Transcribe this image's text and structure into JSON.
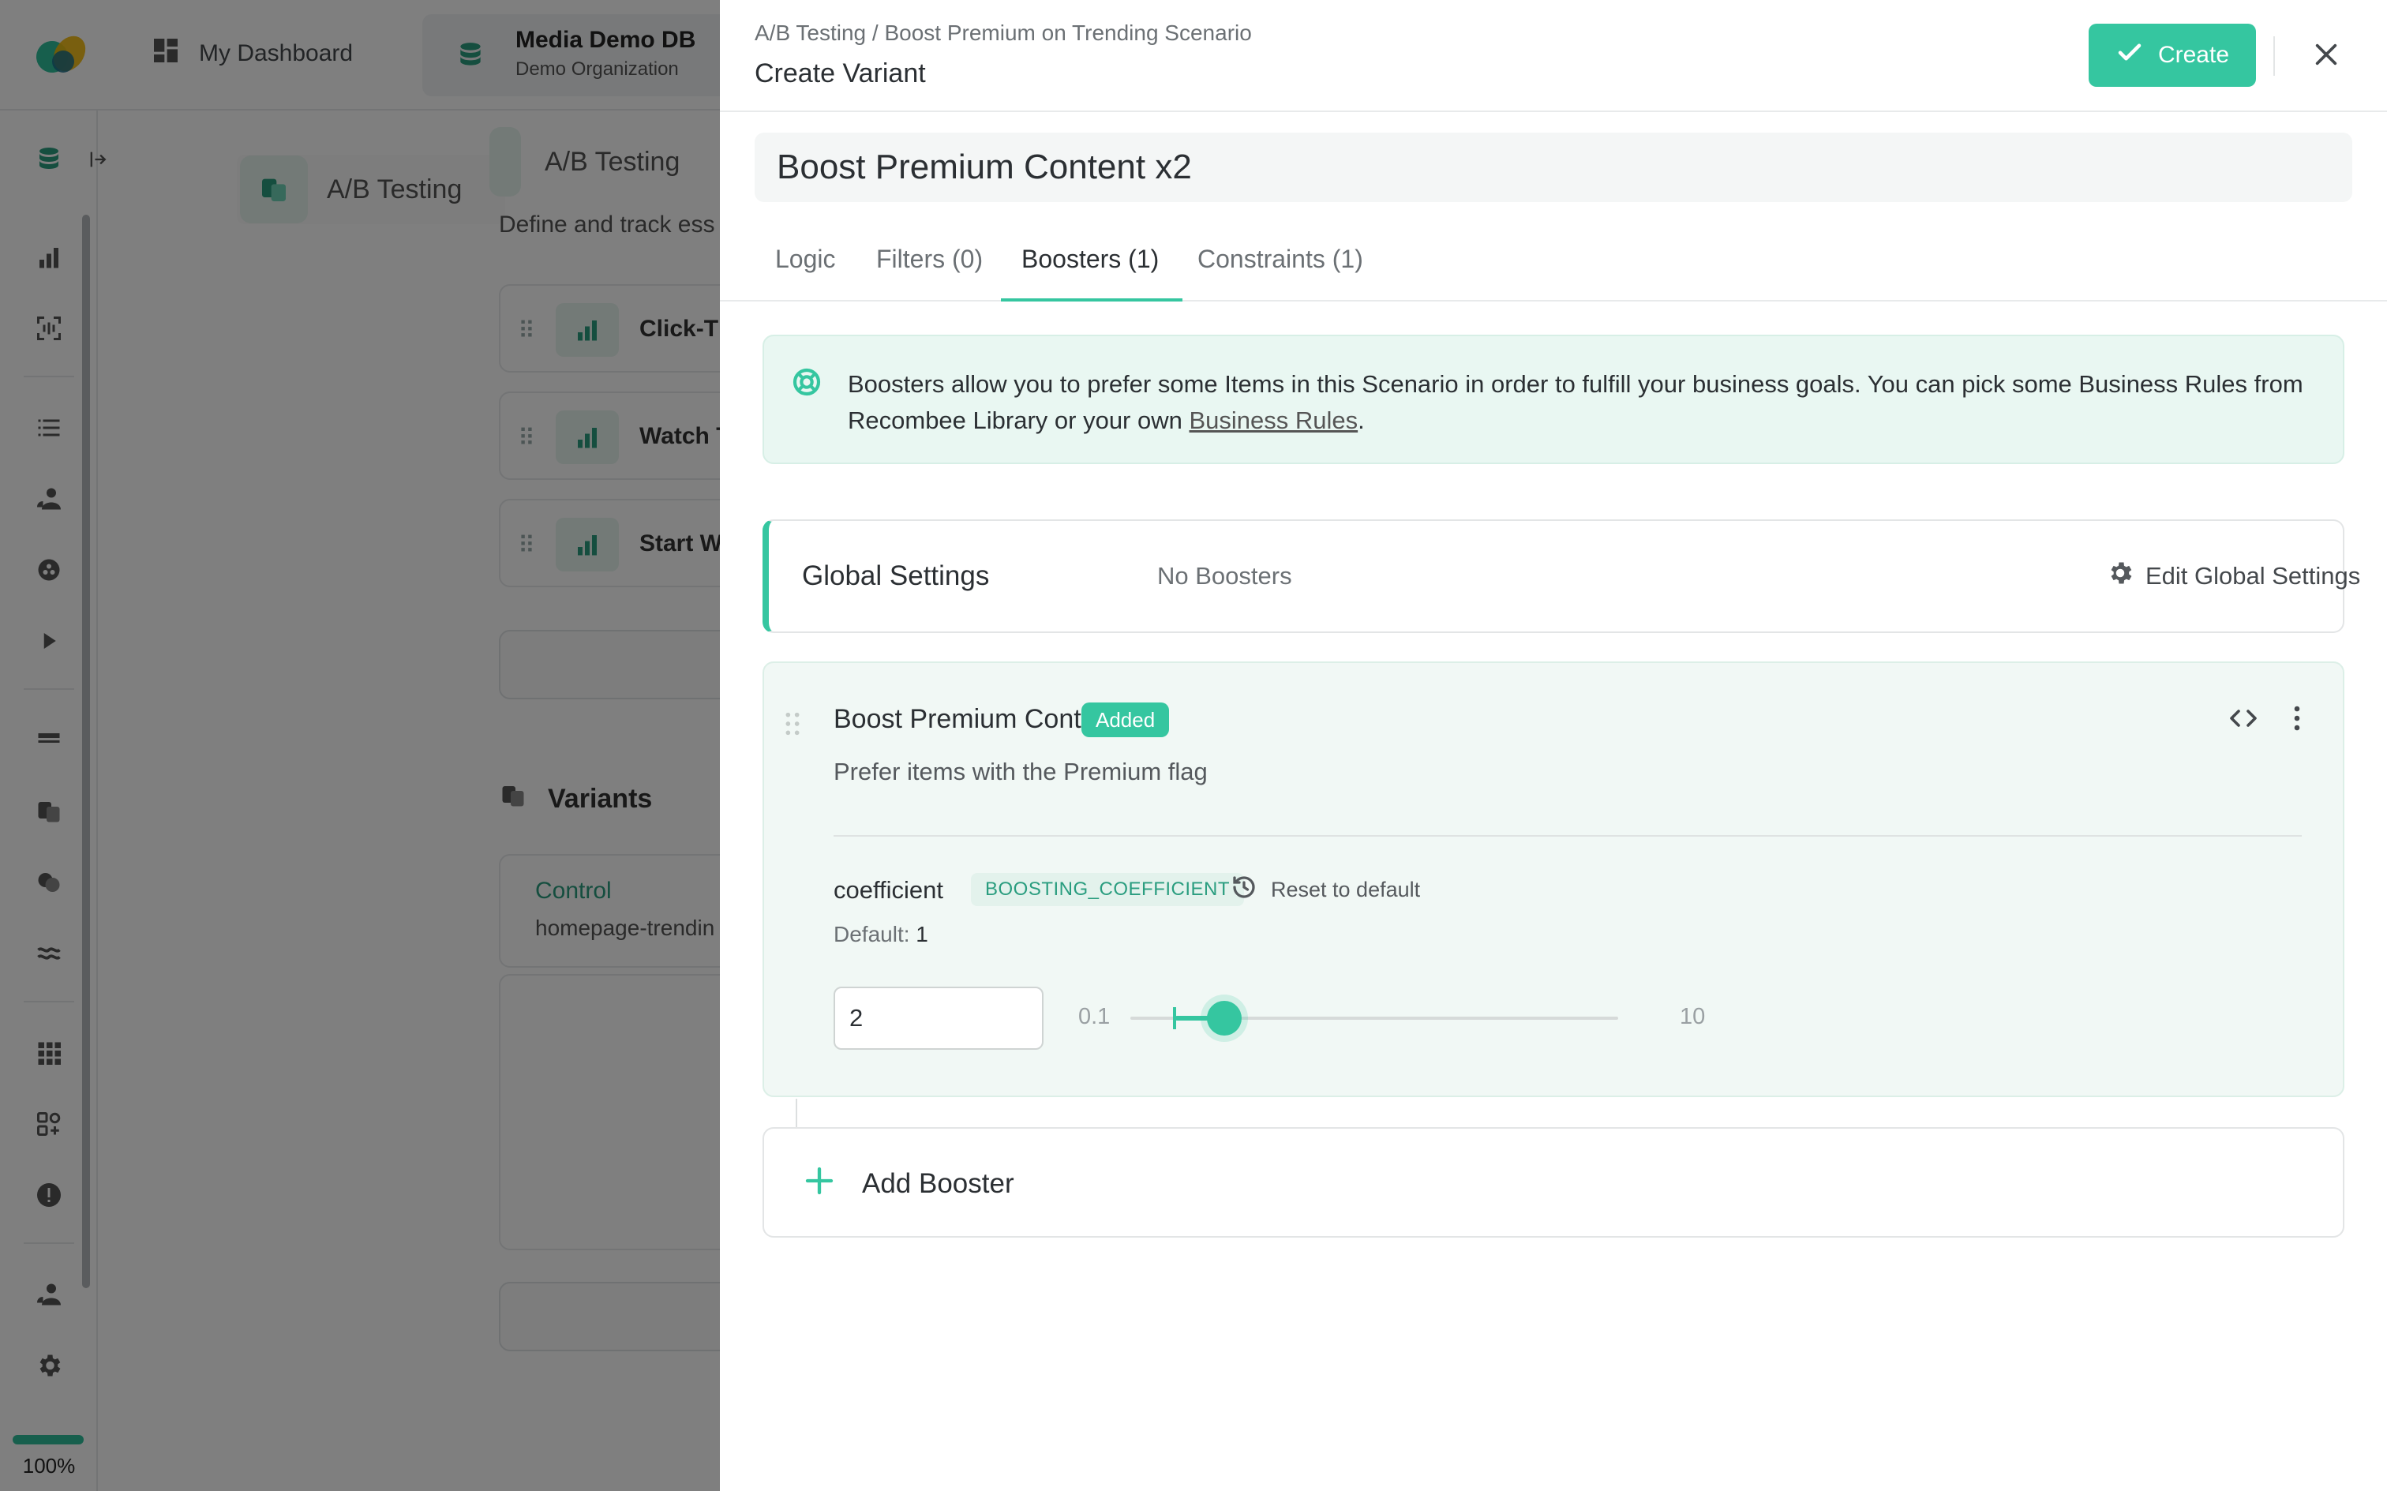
{
  "background": {
    "nav": {
      "dashboard": "My Dashboard",
      "db_name": "Media Demo DB",
      "org_name": "Demo Organization"
    },
    "tabs": {
      "ab_testing_1": "A/B Testing",
      "ab_testing_2": "A/B Testing"
    },
    "description": "Define and track ess",
    "metrics": [
      "Click-Th",
      "Watch T",
      "Start W"
    ],
    "variants_heading": "Variants",
    "control": {
      "name": "Control",
      "scenario": "homepage-trendin"
    },
    "progress_label": "100%"
  },
  "drawer": {
    "breadcrumb": "A/B Testing / Boost Premium on Trending Scenario",
    "title": "Create Variant",
    "create_label": "Create",
    "variant_name": "Boost Premium Content x2",
    "tabs": [
      {
        "label": "Logic"
      },
      {
        "label": "Filters (0)"
      },
      {
        "label": "Boosters (1)"
      },
      {
        "label": "Constraints (1)"
      }
    ],
    "active_tab": "Boosters (1)",
    "info": {
      "text": "Boosters allow you to prefer some Items in this Scenario in order to fulfill your business goals. You can pick some Business Rules from Recombee Library or your own ",
      "link": "Business Rules",
      "suffix": "."
    },
    "global_settings": {
      "title": "Global Settings",
      "status": "No Boosters",
      "edit_label": "Edit Global Settings"
    },
    "booster": {
      "name": "Boost Premium Content",
      "badge": "Added",
      "description": "Prefer items with the Premium flag",
      "param": {
        "name": "coefficient",
        "tag": "BOOSTING_COEFFICIENT",
        "reset_label": "Reset to default",
        "default_label": "Default:",
        "default_value": "1",
        "value": "2",
        "min": "0.1",
        "max": "10",
        "slider_value": 2,
        "slider_default": 1
      }
    },
    "add_booster_label": "Add Booster"
  },
  "colors": {
    "accent": "#35c6a0",
    "accent_dark": "#2a9d7f",
    "info_bg": "#e9f7f2",
    "booster_bg": "#f1f8f5"
  }
}
